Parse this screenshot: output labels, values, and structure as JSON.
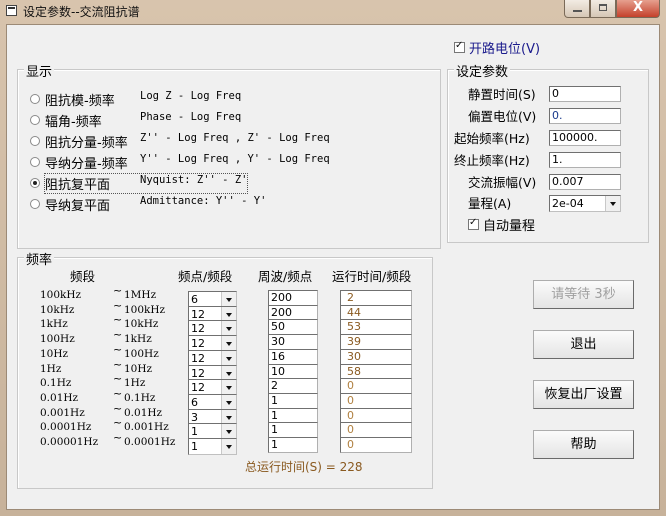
{
  "window": {
    "title": "设定参数--交流阻抗谱",
    "controls": {
      "minimize": "minimize-icon",
      "maximize": "maximize-icon",
      "close": "X"
    }
  },
  "open_circuit": {
    "label": "开路电位(V)",
    "checked": true,
    "color": "#1a1a8c"
  },
  "display": {
    "title": "显示",
    "selected_index": 4,
    "options": [
      {
        "label": "阻抗模-频率",
        "desc": "Log Z - Log Freq"
      },
      {
        "label": "辐角-频率",
        "desc": "Phase - Log Freq"
      },
      {
        "label": "阻抗分量-频率",
        "desc": "Z'' - Log Freq , Z' - Log Freq"
      },
      {
        "label": "导纳分量-频率",
        "desc": "Y'' - Log Freq , Y' - Log Freq"
      },
      {
        "label": "阻抗复平面",
        "desc": "Nyquist:    Z'' - Z'"
      },
      {
        "label": "导纳复平面",
        "desc": "Admittance: Y'' - Y'"
      }
    ]
  },
  "params": {
    "title": "设定参数",
    "fields": [
      {
        "label": "静置时间(S)",
        "value": "0"
      },
      {
        "label": "偏置电位(V)",
        "value": "0."
      },
      {
        "label": "起始频率(Hz)",
        "value": "100000."
      },
      {
        "label": "终止频率(Hz)",
        "value": "1."
      },
      {
        "label": "交流振幅(V)",
        "value": "0.007"
      }
    ],
    "range": {
      "label": "量程(A)",
      "value": "2e-04"
    },
    "auto_range": {
      "label": "自动量程",
      "checked": true
    }
  },
  "frequency": {
    "title": "频率",
    "headers": {
      "band": "频段",
      "points": "频点/频段",
      "cycles": "周波/频点",
      "runtime": "运行时间/频段"
    },
    "rows": [
      {
        "from": "100kHz",
        "to": "1MHz",
        "points": "6",
        "cycles": "200",
        "runtime": "2"
      },
      {
        "from": "10kHz",
        "to": "100kHz",
        "points": "12",
        "cycles": "200",
        "runtime": "44"
      },
      {
        "from": "1kHz",
        "to": "10kHz",
        "points": "12",
        "cycles": "50",
        "runtime": "53"
      },
      {
        "from": "100Hz",
        "to": "1kHz",
        "points": "12",
        "cycles": "30",
        "runtime": "39"
      },
      {
        "from": "10Hz",
        "to": "100Hz",
        "points": "12",
        "cycles": "16",
        "runtime": "30"
      },
      {
        "from": "1Hz",
        "to": "10Hz",
        "points": "12",
        "cycles": "10",
        "runtime": "58"
      },
      {
        "from": "0.1Hz",
        "to": "1Hz",
        "points": "12",
        "cycles": "2",
        "runtime": "0"
      },
      {
        "from": "0.01Hz",
        "to": "0.1Hz",
        "points": "6",
        "cycles": "1",
        "runtime": "0"
      },
      {
        "from": "0.001Hz",
        "to": "0.01Hz",
        "points": "3",
        "cycles": "1",
        "runtime": "0"
      },
      {
        "from": "0.0001Hz",
        "to": "0.001Hz",
        "points": "1",
        "cycles": "1",
        "runtime": "0"
      },
      {
        "from": "0.00001Hz",
        "to": "0.0001Hz",
        "points": "1",
        "cycles": "1",
        "runtime": "0"
      }
    ],
    "tilde": "~",
    "total": "总运行时间(S) = 228"
  },
  "buttons": {
    "wait": "请等待 3秒",
    "exit": "退出",
    "restore": "恢复出厂设置",
    "help": "帮助"
  }
}
